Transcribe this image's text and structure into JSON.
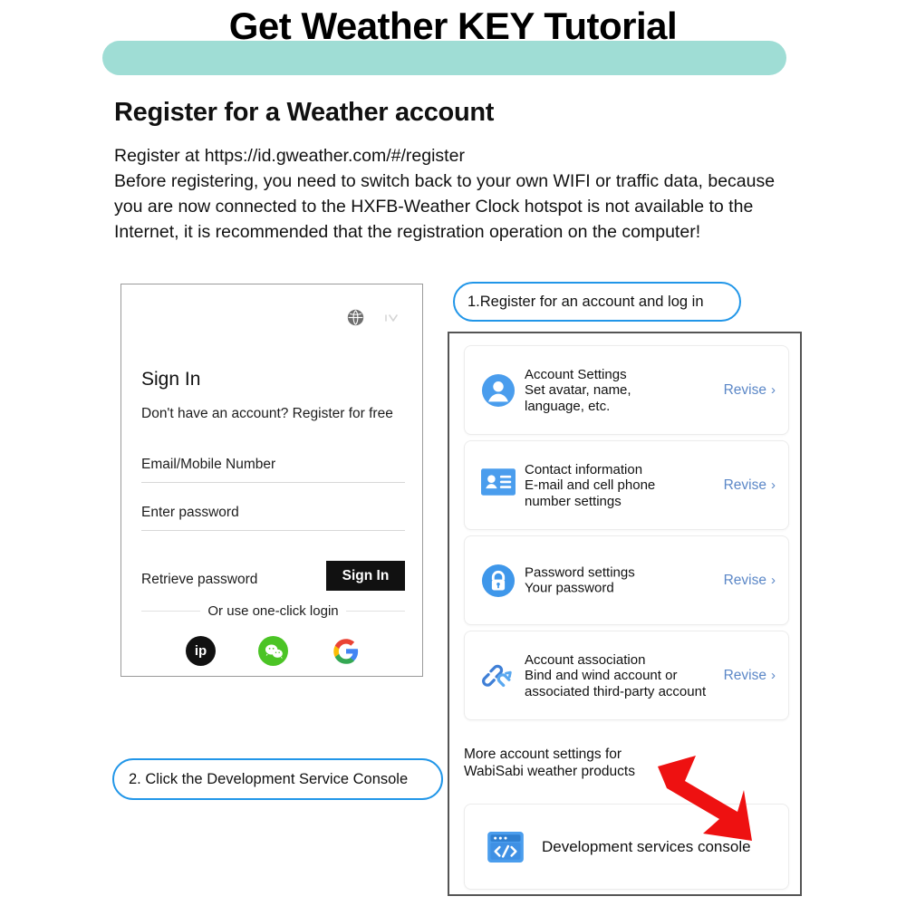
{
  "header": {
    "title": "Get Weather KEY Tutorial",
    "banner_color": "#9fddd5"
  },
  "section": {
    "heading": "Register for a Weather account",
    "paragraph_lines": [
      "Register at https://id.gweather.com/#/register",
      "Before registering, you need to switch back to your own WIFI or traffic data, because",
      "you are now connected to the HXFB-Weather Clock hotspot is not available to the",
      "Internet, it is recommended that the registration operation on the computer!"
    ]
  },
  "signin": {
    "title": "Sign In",
    "subtitle": "Don't have an account? Register for free",
    "email_label": "Email/Mobile Number",
    "email_value": "",
    "password_label": "Enter password",
    "password_value": "",
    "retrieve_label": "Retrieve password",
    "submit_label": "Sign In",
    "divider_label": "Or use one-click login",
    "globe_icon": "globe-icon",
    "chevron_icon": "chevron-down-icon",
    "social": [
      {
        "name": "ip-login-icon",
        "label": "ip",
        "color": "#111111"
      },
      {
        "name": "wechat-login-icon",
        "label": "",
        "color": "#4bc425"
      },
      {
        "name": "google-login-icon",
        "label": "",
        "color": "#4285f4"
      }
    ]
  },
  "callouts": {
    "step1": "1.Register for an account and log in",
    "step2": "2. Click the Development Service Console",
    "border_color": "#2196e8"
  },
  "settings": {
    "revise_label": "Revise",
    "revise_chevron": "›",
    "revise_color": "#5b87c7",
    "rows": [
      {
        "icon": "account-avatar-icon",
        "title": "Account Settings",
        "desc_lines": [
          "Set avatar, name,",
          "language, etc."
        ],
        "action": "Revise"
      },
      {
        "icon": "contact-card-icon",
        "title": "Contact information",
        "desc_lines": [
          "E-mail and cell phone",
          "number settings"
        ],
        "action": "Revise"
      },
      {
        "icon": "lock-icon",
        "title": "Password settings",
        "desc_lines": [
          "Your password"
        ],
        "action": "Revise"
      },
      {
        "icon": "chain-link-icon",
        "title": "Account association",
        "desc_lines": [
          "Bind and wind account or",
          "associated third-party account"
        ],
        "action": "Revise"
      }
    ],
    "more_note_lines": [
      "More account settings for",
      "WabiSabi weather products"
    ],
    "dev_console": {
      "icon": "code-window-icon",
      "label": "Development services console"
    },
    "arrow": {
      "name": "red-arrow-icon",
      "color": "#ee1111"
    }
  }
}
